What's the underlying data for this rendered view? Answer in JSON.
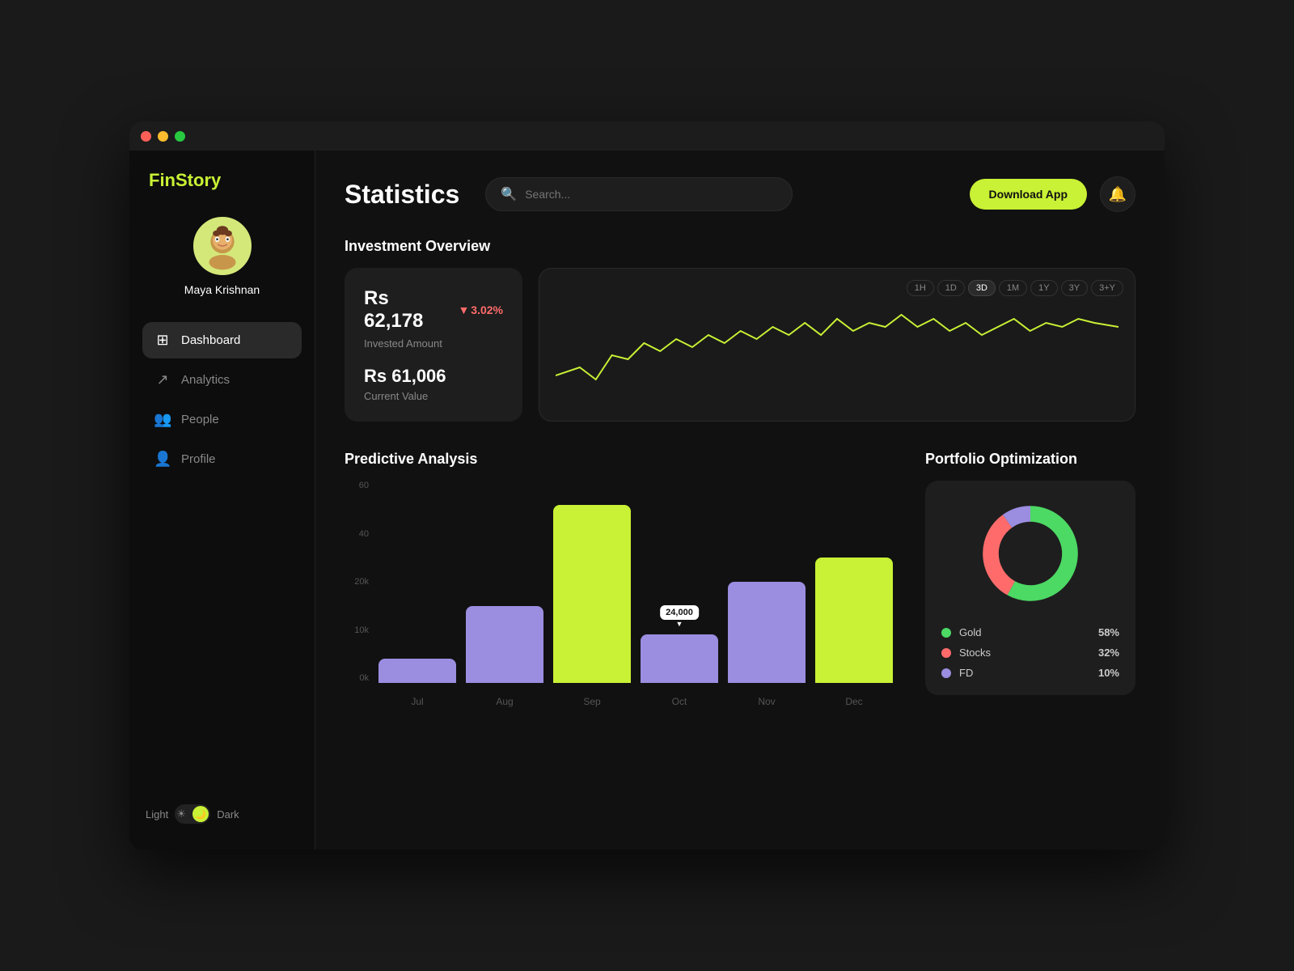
{
  "window": {
    "title": "FinStory"
  },
  "logo": {
    "prefix": "Fin",
    "suffix": "Story"
  },
  "user": {
    "name": "Maya Krishnan",
    "avatar_emoji": "🧑"
  },
  "nav": {
    "items": [
      {
        "id": "dashboard",
        "label": "Dashboard",
        "icon": "⊞",
        "active": true
      },
      {
        "id": "analytics",
        "label": "Analytics",
        "icon": "↗",
        "active": false
      },
      {
        "id": "people",
        "label": "People",
        "icon": "👥",
        "active": false
      },
      {
        "id": "profile",
        "label": "Profile",
        "icon": "👤",
        "active": false
      }
    ]
  },
  "theme": {
    "light_label": "Light",
    "dark_label": "Dark"
  },
  "header": {
    "page_title": "Statistics",
    "search_placeholder": "Search...",
    "download_btn": "Download App"
  },
  "investment_overview": {
    "title": "Investment Overview",
    "amount": "Rs 62,178",
    "change": "3.02%",
    "invested_label": "Invested Amount",
    "current_value": "Rs 61,006",
    "current_label": "Current Value",
    "timeframes": [
      "1H",
      "1D",
      "3D",
      "1M",
      "1Y",
      "3Y",
      "3+Y"
    ],
    "active_timeframe": "3D"
  },
  "predictive_analysis": {
    "title": "Predictive Analysis",
    "tooltip_value": "24,000",
    "y_labels": [
      "60",
      "40",
      "20k",
      "10k",
      "0k"
    ],
    "bars": [
      {
        "month": "Jul",
        "yellow": 10,
        "purple": 0,
        "active": false
      },
      {
        "month": "Aug",
        "yellow": 0,
        "purple": 38,
        "active": false
      },
      {
        "month": "Sep",
        "yellow": 90,
        "purple": 0,
        "active": false
      },
      {
        "month": "Oct",
        "yellow": 0,
        "purple": 24,
        "active": true
      },
      {
        "month": "Nov",
        "yellow": 0,
        "purple": 50,
        "active": false
      },
      {
        "month": "Dec",
        "yellow": 60,
        "purple": 0,
        "active": false
      }
    ]
  },
  "portfolio": {
    "title": "Portfolio Optimization",
    "segments": [
      {
        "label": "Gold",
        "pct": 58,
        "color": "#4cd964",
        "stroke_pct": 58
      },
      {
        "label": "Stocks",
        "pct": 32,
        "color": "#ff6b6b",
        "stroke_pct": 32
      },
      {
        "label": "FD",
        "pct": 10,
        "color": "#9b8de0",
        "stroke_pct": 10
      }
    ]
  }
}
